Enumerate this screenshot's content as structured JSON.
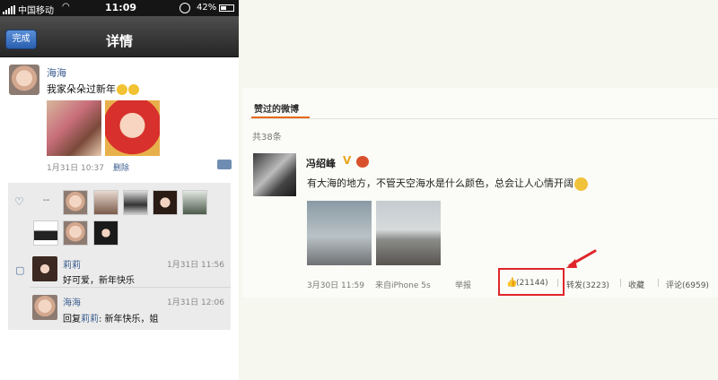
{
  "status_bar": {
    "carrier": "中国移动",
    "time": "11:09",
    "battery": "42%"
  },
  "nav": {
    "done_label": "完成",
    "title": "详情"
  },
  "post": {
    "author": "海海",
    "text": "我家朵朵过新年",
    "time": "1月31日 10:37",
    "delete_label": "删除"
  },
  "likes": {
    "dash": "--"
  },
  "comments": [
    {
      "author": "莉莉",
      "time": "1月31日 11:56",
      "text": "好可爱，新年快乐"
    },
    {
      "author": "海海",
      "time": "1月31日 12:06",
      "reply_prefix": "回复",
      "reply_to": "莉莉",
      "text": ": 新年快乐，姐"
    }
  ],
  "weibo": {
    "section_title": "赞过的微博",
    "total": "共38条",
    "author": "冯绍峰",
    "verified": "V",
    "text": "有大海的地方，不管天空海水是什么颜色，总会让人心情开阔",
    "time": "3月30日 11:59",
    "source": "来自iPhone 5s",
    "report": "举报",
    "like_count": "(21144)",
    "repost": "转发(3223)",
    "favorite": "收藏",
    "comment": "评论(6959)",
    "separator": "|"
  },
  "colors": {
    "highlight": "#e0252a",
    "link": "#3a5d8f",
    "accent": "#e36a1a"
  },
  "icons": [
    "signal-icon",
    "wifi-icon",
    "lock-rotation-icon",
    "battery-icon",
    "smile-icon",
    "heart-icon",
    "comment-bubble-icon",
    "verified-icon",
    "medal-icon",
    "grin-icon",
    "thumbs-up-icon",
    "red-arrow-icon"
  ]
}
